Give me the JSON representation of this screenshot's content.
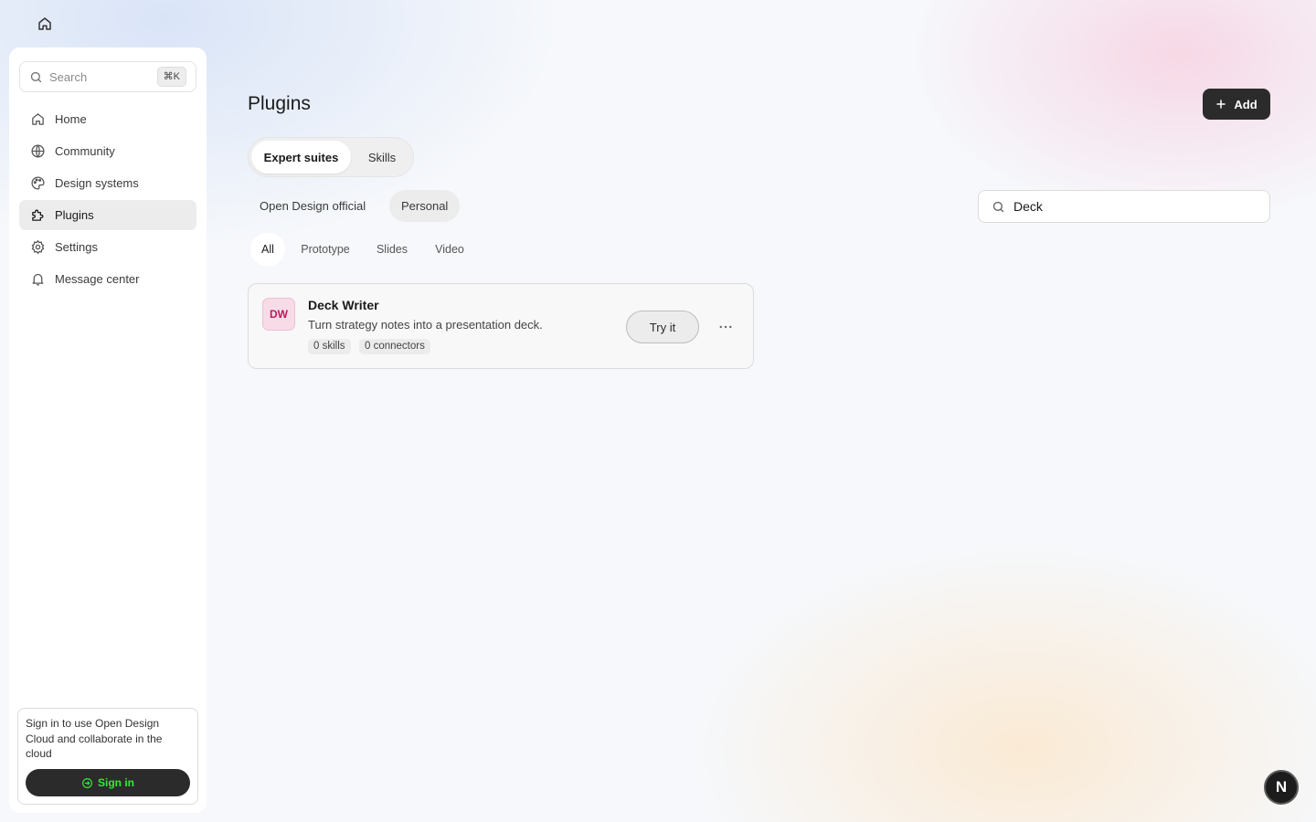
{
  "topbar": {
    "home_icon": "home-icon"
  },
  "sidebar": {
    "search": {
      "label": "Search",
      "shortcut": "⌘K"
    },
    "items": [
      {
        "label": "Home",
        "icon": "home-icon",
        "active": false
      },
      {
        "label": "Community",
        "icon": "globe-icon",
        "active": false
      },
      {
        "label": "Design systems",
        "icon": "palette-icon",
        "active": false
      },
      {
        "label": "Plugins",
        "icon": "puzzle-icon",
        "active": true
      },
      {
        "label": "Settings",
        "icon": "gear-icon",
        "active": false
      },
      {
        "label": "Message center",
        "icon": "bell-icon",
        "active": false
      }
    ],
    "signin": {
      "text": "Sign in to use Open Design Cloud and collaborate in the cloud",
      "button_label": "Sign in",
      "button_color": "#39e639"
    }
  },
  "main": {
    "title": "Plugins",
    "add_label": "Add",
    "segments": [
      {
        "label": "Expert suites",
        "active": true
      },
      {
        "label": "Skills",
        "active": false
      }
    ],
    "filters": [
      {
        "label": "Open Design official",
        "active": false
      },
      {
        "label": "Personal",
        "active": true
      }
    ],
    "search": {
      "value": "Deck"
    },
    "categories": [
      {
        "label": "All",
        "active": true
      },
      {
        "label": "Prototype",
        "active": false
      },
      {
        "label": "Slides",
        "active": false
      },
      {
        "label": "Video",
        "active": false
      }
    ],
    "cards": [
      {
        "initials": "DW",
        "title": "Deck Writer",
        "description": "Turn strategy notes into a presentation deck.",
        "chips": [
          "0 skills",
          "0 connectors"
        ],
        "try_label": "Try it",
        "more_icon": "more-horizontal-icon"
      }
    ]
  },
  "badge": {
    "letter": "N"
  },
  "colors": {
    "accent_dark": "#2b2b2b",
    "avatar_bg": "#f7dce8",
    "avatar_text": "#c2185b"
  }
}
